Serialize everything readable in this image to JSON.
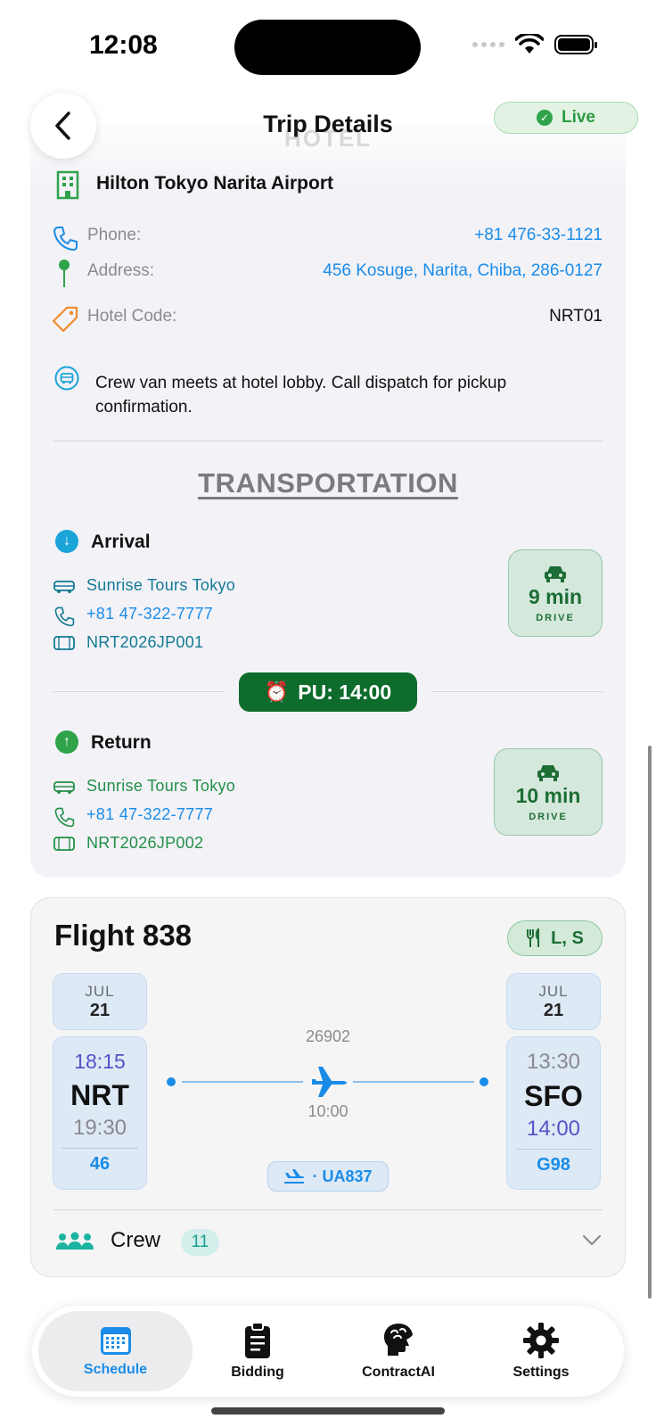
{
  "status_bar": {
    "time": "12:08"
  },
  "header": {
    "title": "Trip Details",
    "live_label": "Live",
    "ghost_section": "HOTEL"
  },
  "hotel": {
    "name": "Hilton Tokyo Narita Airport",
    "rows": [
      {
        "label": "Phone:",
        "value": "+81 476-33-1121"
      },
      {
        "label": "Address:",
        "value": "456 Kosuge, Narita, Chiba, 286-0127"
      },
      {
        "label": "Hotel Code:",
        "value": "NRT01"
      }
    ],
    "note": "Crew van meets at hotel lobby. Call dispatch for pickup confirmation."
  },
  "transportation": {
    "title": "TRANSPORTATION",
    "arrival": {
      "title": "Arrival",
      "company": "Sunrise Tours Tokyo",
      "phone": "+81 47-322-7777",
      "confirmation": "NRT2026JP001",
      "drive_time": "9 min",
      "drive_label": "DRIVE"
    },
    "pickup": "PU: 14:00",
    "return": {
      "title": "Return",
      "company": "Sunrise Tours Tokyo",
      "phone": "+81 47-322-7777",
      "confirmation": "NRT2026JP002",
      "drive_time": "10 min",
      "drive_label": "DRIVE"
    }
  },
  "flight": {
    "title": "Flight 838",
    "meals": "L, S",
    "departure": {
      "month": "JUL",
      "day": "21",
      "scheduled": "18:15",
      "code": "NRT",
      "actual": "19:30",
      "gate": "46"
    },
    "arrival": {
      "month": "JUL",
      "day": "21",
      "scheduled": "13:30",
      "code": "SFO",
      "actual": "14:00",
      "gate": "G98"
    },
    "flight_number": "26902",
    "duration": "10:00",
    "inbound": "· UA837",
    "crew_label": "Crew",
    "crew_count": "11"
  },
  "tabs": [
    {
      "label": "Schedule",
      "icon": "calendar-icon",
      "active": true
    },
    {
      "label": "Bidding",
      "icon": "clipboard-icon",
      "active": false
    },
    {
      "label": "ContractAI",
      "icon": "brain-icon",
      "active": false
    },
    {
      "label": "Settings",
      "icon": "gear-icon",
      "active": false
    }
  ],
  "colors": {
    "accent": "#1a8ce8",
    "live_green": "#2c9a45",
    "pickup_green": "#0d6b2b",
    "arrival_teal": "#137a93"
  }
}
